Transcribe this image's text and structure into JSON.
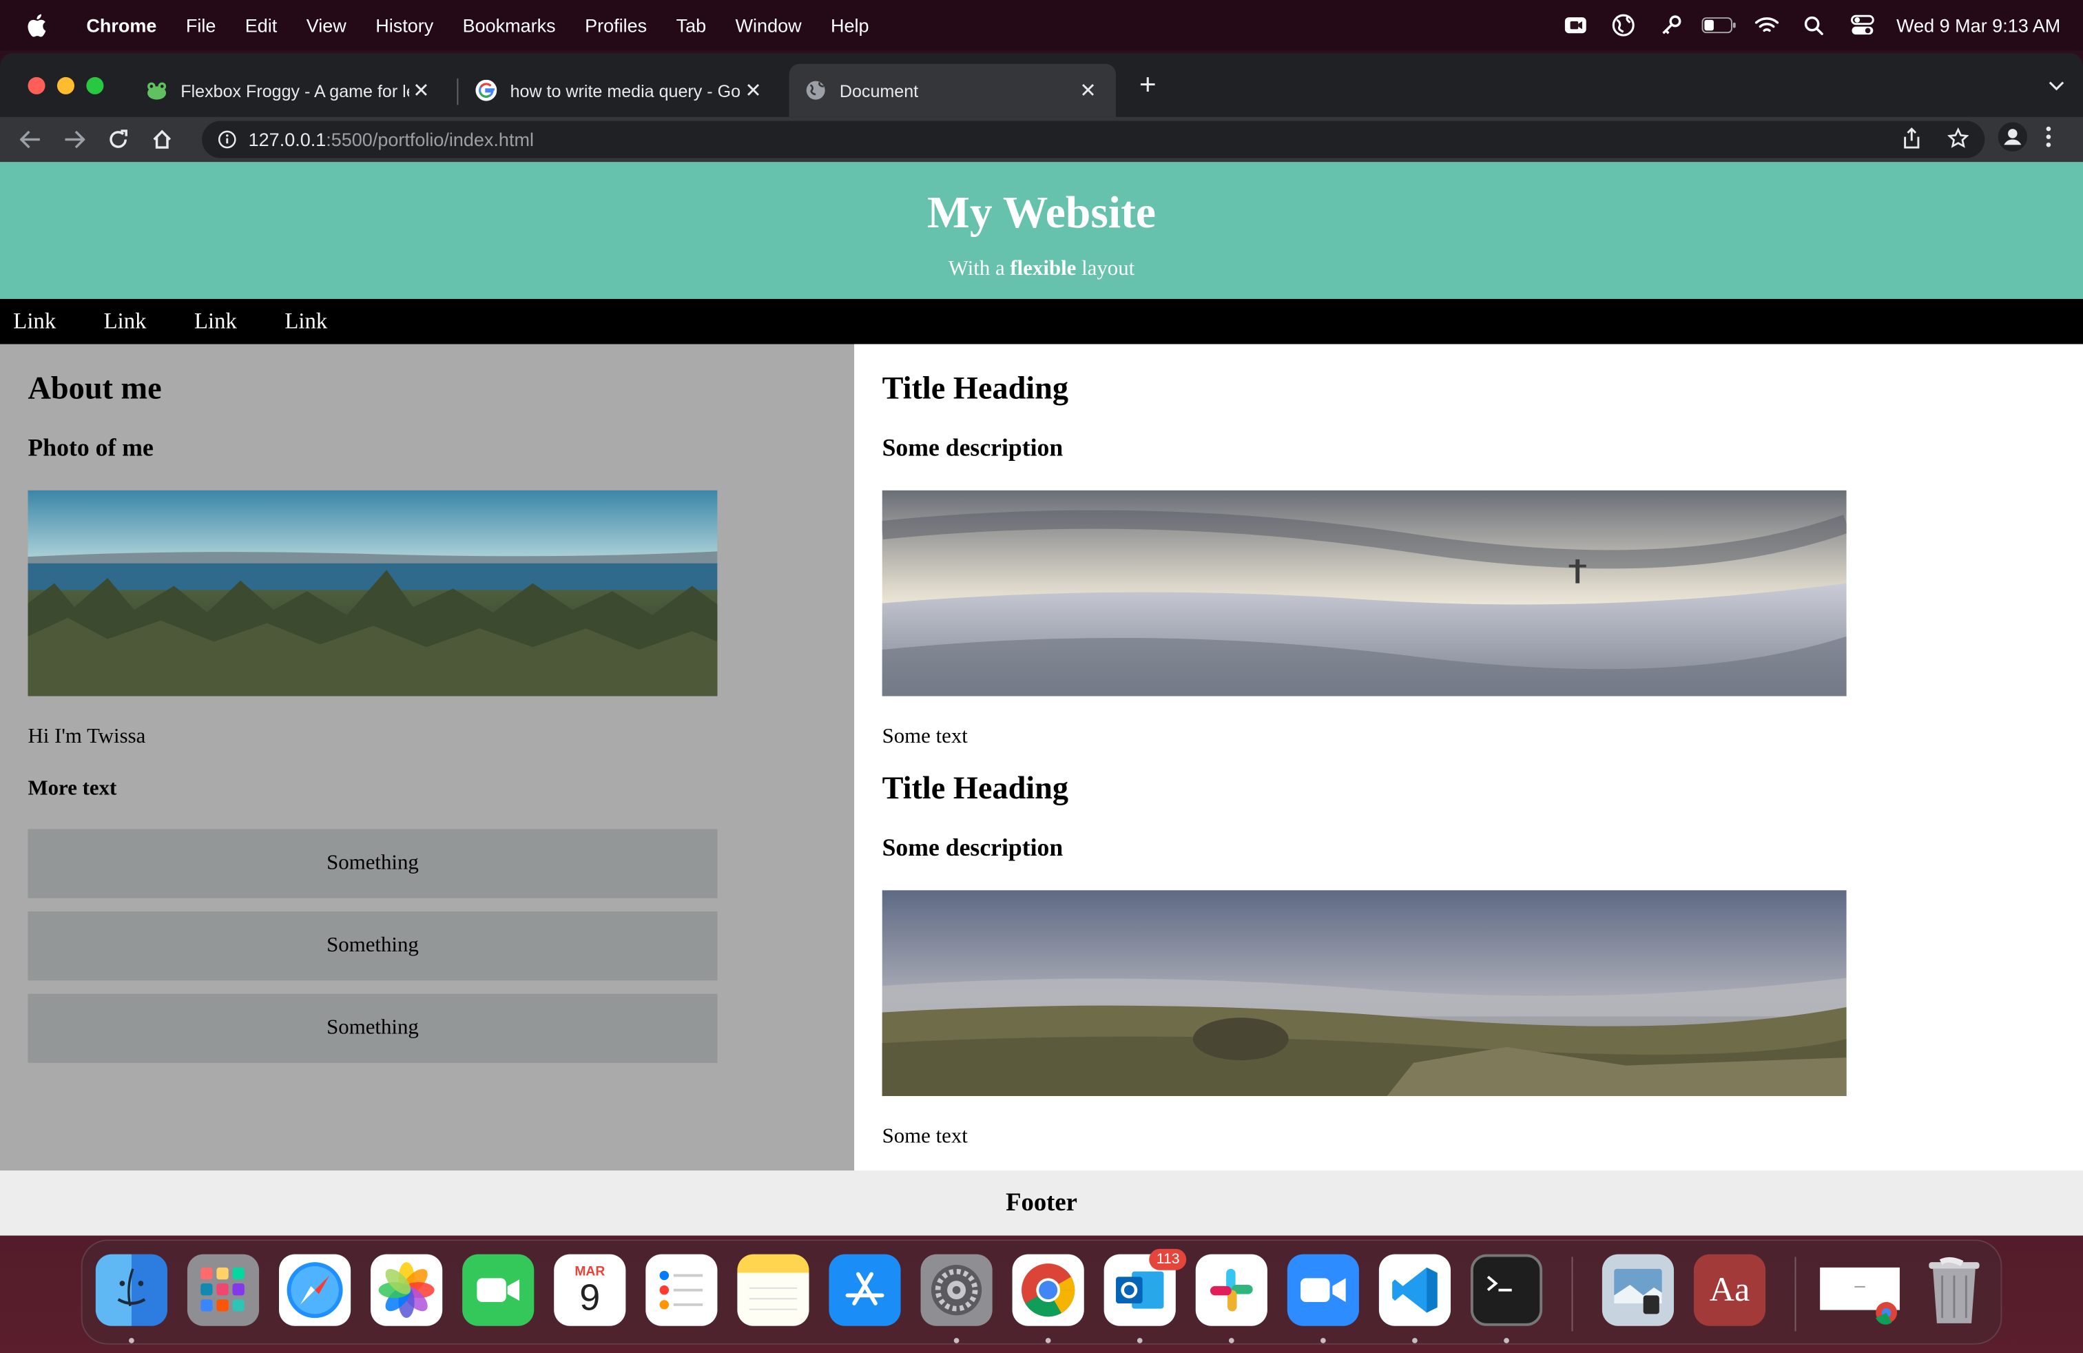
{
  "menubar": {
    "app_name": "Chrome",
    "items": [
      "File",
      "Edit",
      "View",
      "History",
      "Bookmarks",
      "Profiles",
      "Tab",
      "Window",
      "Help"
    ],
    "clock": "Wed 9 Mar  9:13 AM"
  },
  "browser": {
    "tabs": [
      {
        "title": "Flexbox Froggy - A game for le",
        "favicon": "frog-icon"
      },
      {
        "title": "how to write media query - Go",
        "favicon": "google-icon"
      },
      {
        "title": "Document",
        "favicon": "globe-icon",
        "active": true
      }
    ],
    "url": {
      "host": "127.0.0.1",
      "path": ":5500/portfolio/index.html"
    }
  },
  "site": {
    "title": "My Website",
    "subtitle_pre": "With a ",
    "subtitle_bold": "flexible",
    "subtitle_post": " layout",
    "nav": [
      "Link",
      "Link",
      "Link",
      "Link"
    ],
    "side": {
      "heading": "About me",
      "subheading": "Photo of me",
      "intro": "Hi I'm Twissa",
      "more": "More text",
      "boxes": [
        "Something",
        "Something",
        "Something"
      ]
    },
    "main": {
      "posts": [
        {
          "title": "Title Heading",
          "description": "Some description",
          "text": "Some text"
        },
        {
          "title": "Title Heading",
          "description": "Some description",
          "text": "Some text"
        }
      ]
    },
    "footer": "Footer"
  },
  "dock": {
    "apps": [
      "finder-icon",
      "launchpad-icon",
      "safari-icon",
      "photos-icon",
      "facetime-icon",
      "calendar-icon",
      "reminders-icon",
      "notes-icon",
      "app-store-icon",
      "system-preferences-icon",
      "chrome-icon",
      "outlook-icon",
      "slack-icon",
      "zoom-icon",
      "vscode-icon",
      "terminal-icon",
      "preview-icon",
      "dictionary-icon",
      "chrome-window-icon",
      "trash-icon"
    ],
    "calendar_month": "MAR",
    "calendar_day": "9",
    "outlook_badge": "113",
    "dictionary_label": "Aa"
  }
}
